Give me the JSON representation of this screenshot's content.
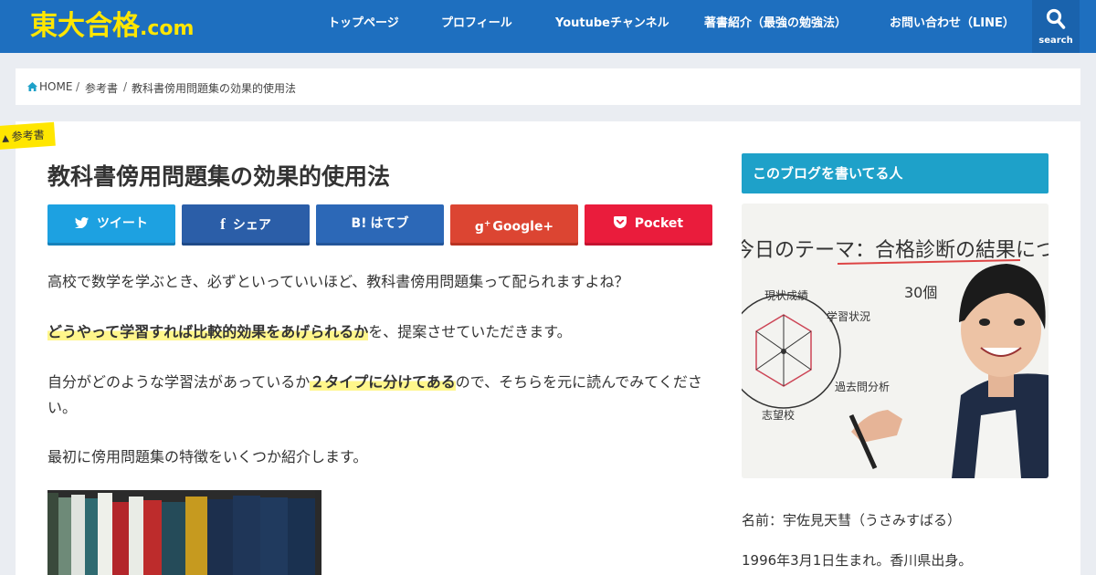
{
  "site": {
    "logo_main": "東大合格",
    "logo_suffix": ".com"
  },
  "nav": {
    "items": [
      "トップページ",
      "プロフィール",
      "Youtubeチャンネル",
      "著書紹介（最強の勉強法）",
      "お問い合わせ（LINE）"
    ],
    "search_label": "search"
  },
  "breadcrumb": {
    "home": "HOME",
    "category": "参考書",
    "current": "教科書傍用問題集の効果的使用法"
  },
  "article": {
    "category_label": "参考書",
    "title": "教科書傍用問題集の効果的使用法",
    "share": {
      "tweet": "ツイート",
      "facebook": "シェア",
      "hatena": "はてブ",
      "google": "Google+",
      "pocket": "Pocket"
    },
    "p1": "高校で数学を学ぶとき、必ずといっていいほど、教科書傍用問題集って配られますよね？",
    "p2_highlight": "どうやって学習すれば比較的効果をあげられるか",
    "p2_rest": "を、提案させていただきます。",
    "p3_before": "自分がどのような学習法があっているか",
    "p3_highlight": "２タイプに分けてある",
    "p3_after": "ので、そちらを元に読んでみてくださ",
    "p3_wrap": "い。",
    "p4": "最初に傍用問題集の特徴をいくつか紹介します。"
  },
  "sidebar": {
    "widget_title": "このブログを書いてる人",
    "whiteboard_title": "今日のテーマ：合格診断の結果について",
    "chart_labels": [
      "現状成績",
      "学習状況",
      "過去問分析",
      "志望校"
    ],
    "whiteboard_count": "30個",
    "name_line": "名前：宇佐見天彗（うさみすばる）",
    "birth_line": "1996年3月1日生まれ。香川県出身。"
  },
  "colors": {
    "header": "#1e6fbf",
    "logo": "#ffe600",
    "tweet": "#1da1e1",
    "facebook": "#2b5ea8",
    "hatena": "#2c68b7",
    "google": "#dc4532",
    "pocket": "#ea1c3c",
    "sidebar_title": "#1ea1c9"
  }
}
